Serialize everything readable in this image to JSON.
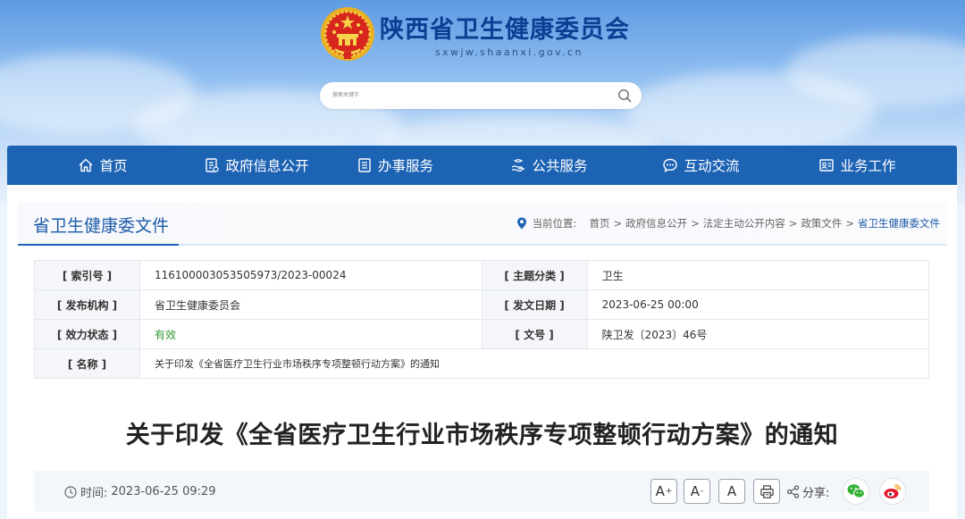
{
  "header": {
    "site_title": "陕西省卫生健康委员会",
    "site_domain": "sxwjw.shaanxi.gov.cn",
    "emblem_icon": "national-emblem-icon"
  },
  "search": {
    "placeholder": "搜索关键字",
    "icon": "search-icon"
  },
  "nav": {
    "items": [
      {
        "label": "首页",
        "icon": "home-icon"
      },
      {
        "label": "政府信息公开",
        "icon": "document-list-icon"
      },
      {
        "label": "办事服务",
        "icon": "form-icon"
      },
      {
        "label": "公共服务",
        "icon": "hand-service-icon"
      },
      {
        "label": "互动交流",
        "icon": "chat-icon"
      },
      {
        "label": "业务工作",
        "icon": "id-card-icon"
      }
    ]
  },
  "section": {
    "title": "省卫生健康委文件"
  },
  "breadcrumb": {
    "prefix": "当前位置:",
    "items": [
      "首页",
      "政府信息公开",
      "法定主动公开内容",
      "政策文件"
    ],
    "current": "省卫生健康委文件",
    "separator": ">"
  },
  "meta": {
    "index_no_label": "[ 索引号 ]",
    "index_no": "116100003053505973/2023-00024",
    "topic_label": "[ 主题分类 ]",
    "topic": "卫生",
    "issuer_label": "[ 发布机构 ]",
    "issuer": "省卫生健康委员会",
    "date_label": "[ 发文日期 ]",
    "date": "2023-06-25 00:00",
    "status_label": "[ 效力状态 ]",
    "status": "有效",
    "doc_no_label": "[ 文号 ]",
    "doc_no": "陕卫发〔2023〕46号",
    "name_label": "[ 名称 ]",
    "name": "关于印发《全省医疗卫生行业市场秩序专项整顿行动方案》的通知"
  },
  "article": {
    "title": "关于印发《全省医疗卫生行业市场秩序专项整顿行动方案》的通知"
  },
  "toolbar": {
    "time_label": "时间:",
    "time_value": "2023-06-25 09:29",
    "font_larger": "A",
    "font_smaller": "A",
    "font_default": "A",
    "share_label": "分享:"
  },
  "colors": {
    "nav_bg": "#1d63b4",
    "title_blue": "#0b3f93",
    "valid_green": "#2f9a2f",
    "wechat_green": "#34b233",
    "weibo_red": "#e6162d"
  }
}
